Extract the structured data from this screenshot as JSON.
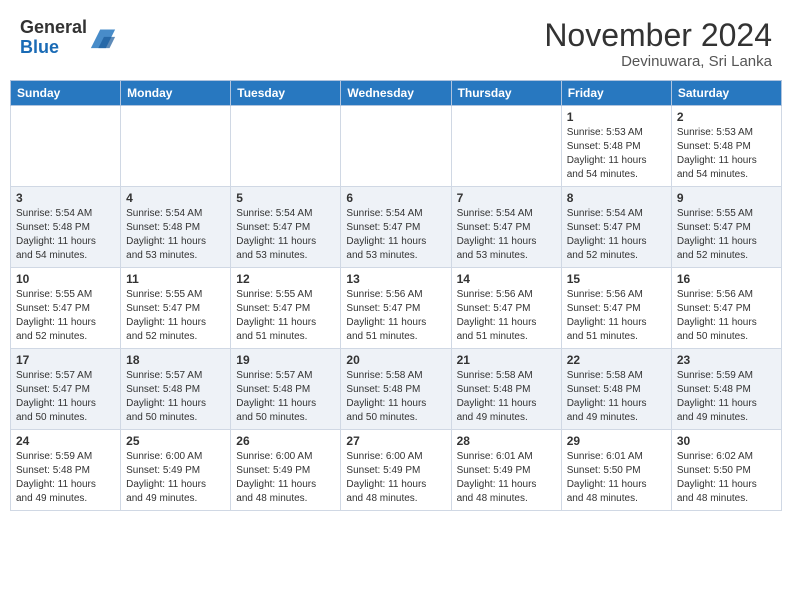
{
  "header": {
    "logo_general": "General",
    "logo_blue": "Blue",
    "month_year": "November 2024",
    "location": "Devinuwara, Sri Lanka"
  },
  "weekdays": [
    "Sunday",
    "Monday",
    "Tuesday",
    "Wednesday",
    "Thursday",
    "Friday",
    "Saturday"
  ],
  "weeks": [
    [
      {
        "day": "",
        "info": ""
      },
      {
        "day": "",
        "info": ""
      },
      {
        "day": "",
        "info": ""
      },
      {
        "day": "",
        "info": ""
      },
      {
        "day": "",
        "info": ""
      },
      {
        "day": "1",
        "info": "Sunrise: 5:53 AM\nSunset: 5:48 PM\nDaylight: 11 hours\nand 54 minutes."
      },
      {
        "day": "2",
        "info": "Sunrise: 5:53 AM\nSunset: 5:48 PM\nDaylight: 11 hours\nand 54 minutes."
      }
    ],
    [
      {
        "day": "3",
        "info": "Sunrise: 5:54 AM\nSunset: 5:48 PM\nDaylight: 11 hours\nand 54 minutes."
      },
      {
        "day": "4",
        "info": "Sunrise: 5:54 AM\nSunset: 5:48 PM\nDaylight: 11 hours\nand 53 minutes."
      },
      {
        "day": "5",
        "info": "Sunrise: 5:54 AM\nSunset: 5:47 PM\nDaylight: 11 hours\nand 53 minutes."
      },
      {
        "day": "6",
        "info": "Sunrise: 5:54 AM\nSunset: 5:47 PM\nDaylight: 11 hours\nand 53 minutes."
      },
      {
        "day": "7",
        "info": "Sunrise: 5:54 AM\nSunset: 5:47 PM\nDaylight: 11 hours\nand 53 minutes."
      },
      {
        "day": "8",
        "info": "Sunrise: 5:54 AM\nSunset: 5:47 PM\nDaylight: 11 hours\nand 52 minutes."
      },
      {
        "day": "9",
        "info": "Sunrise: 5:55 AM\nSunset: 5:47 PM\nDaylight: 11 hours\nand 52 minutes."
      }
    ],
    [
      {
        "day": "10",
        "info": "Sunrise: 5:55 AM\nSunset: 5:47 PM\nDaylight: 11 hours\nand 52 minutes."
      },
      {
        "day": "11",
        "info": "Sunrise: 5:55 AM\nSunset: 5:47 PM\nDaylight: 11 hours\nand 52 minutes."
      },
      {
        "day": "12",
        "info": "Sunrise: 5:55 AM\nSunset: 5:47 PM\nDaylight: 11 hours\nand 51 minutes."
      },
      {
        "day": "13",
        "info": "Sunrise: 5:56 AM\nSunset: 5:47 PM\nDaylight: 11 hours\nand 51 minutes."
      },
      {
        "day": "14",
        "info": "Sunrise: 5:56 AM\nSunset: 5:47 PM\nDaylight: 11 hours\nand 51 minutes."
      },
      {
        "day": "15",
        "info": "Sunrise: 5:56 AM\nSunset: 5:47 PM\nDaylight: 11 hours\nand 51 minutes."
      },
      {
        "day": "16",
        "info": "Sunrise: 5:56 AM\nSunset: 5:47 PM\nDaylight: 11 hours\nand 50 minutes."
      }
    ],
    [
      {
        "day": "17",
        "info": "Sunrise: 5:57 AM\nSunset: 5:47 PM\nDaylight: 11 hours\nand 50 minutes."
      },
      {
        "day": "18",
        "info": "Sunrise: 5:57 AM\nSunset: 5:48 PM\nDaylight: 11 hours\nand 50 minutes."
      },
      {
        "day": "19",
        "info": "Sunrise: 5:57 AM\nSunset: 5:48 PM\nDaylight: 11 hours\nand 50 minutes."
      },
      {
        "day": "20",
        "info": "Sunrise: 5:58 AM\nSunset: 5:48 PM\nDaylight: 11 hours\nand 50 minutes."
      },
      {
        "day": "21",
        "info": "Sunrise: 5:58 AM\nSunset: 5:48 PM\nDaylight: 11 hours\nand 49 minutes."
      },
      {
        "day": "22",
        "info": "Sunrise: 5:58 AM\nSunset: 5:48 PM\nDaylight: 11 hours\nand 49 minutes."
      },
      {
        "day": "23",
        "info": "Sunrise: 5:59 AM\nSunset: 5:48 PM\nDaylight: 11 hours\nand 49 minutes."
      }
    ],
    [
      {
        "day": "24",
        "info": "Sunrise: 5:59 AM\nSunset: 5:48 PM\nDaylight: 11 hours\nand 49 minutes."
      },
      {
        "day": "25",
        "info": "Sunrise: 6:00 AM\nSunset: 5:49 PM\nDaylight: 11 hours\nand 49 minutes."
      },
      {
        "day": "26",
        "info": "Sunrise: 6:00 AM\nSunset: 5:49 PM\nDaylight: 11 hours\nand 48 minutes."
      },
      {
        "day": "27",
        "info": "Sunrise: 6:00 AM\nSunset: 5:49 PM\nDaylight: 11 hours\nand 48 minutes."
      },
      {
        "day": "28",
        "info": "Sunrise: 6:01 AM\nSunset: 5:49 PM\nDaylight: 11 hours\nand 48 minutes."
      },
      {
        "day": "29",
        "info": "Sunrise: 6:01 AM\nSunset: 5:50 PM\nDaylight: 11 hours\nand 48 minutes."
      },
      {
        "day": "30",
        "info": "Sunrise: 6:02 AM\nSunset: 5:50 PM\nDaylight: 11 hours\nand 48 minutes."
      }
    ]
  ]
}
